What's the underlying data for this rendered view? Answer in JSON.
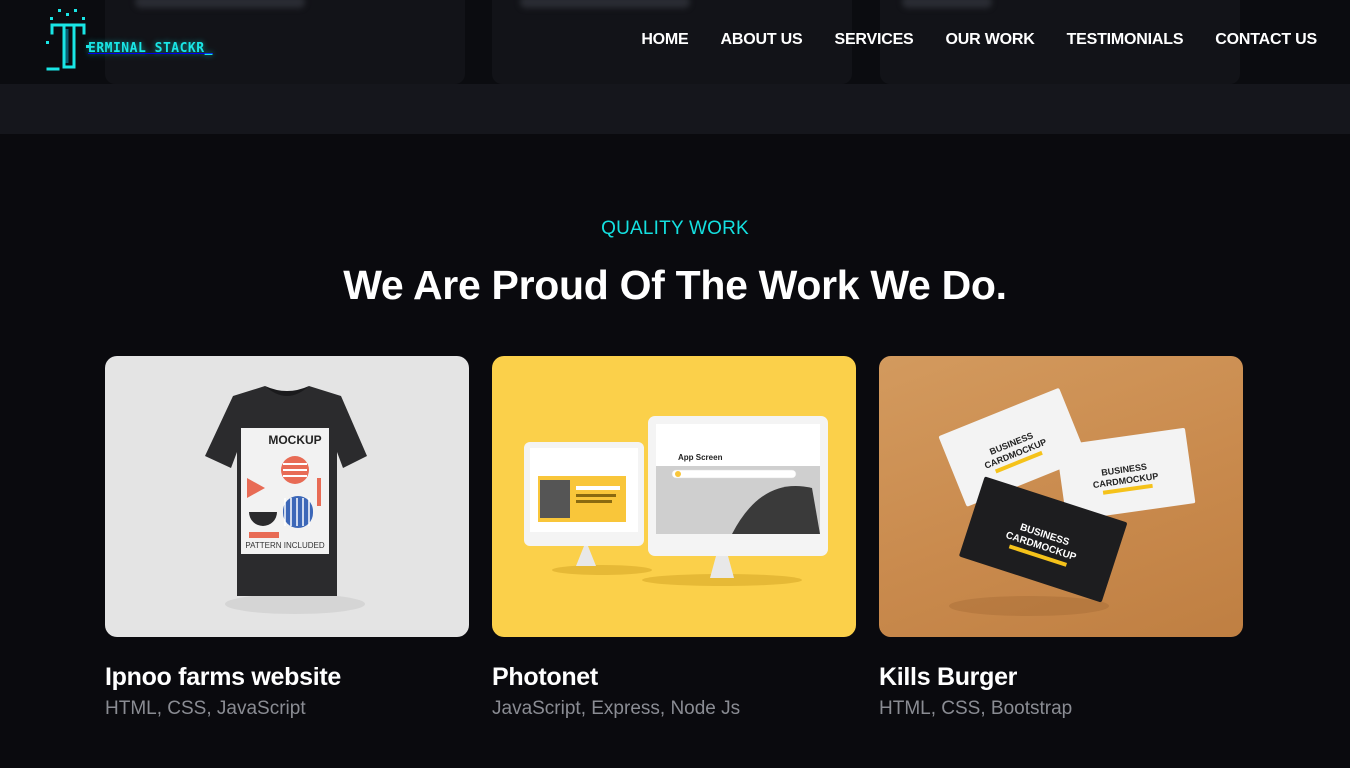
{
  "brand": {
    "logo_text": "ERMINAL STACKR_",
    "accent_color": "#19e6e6"
  },
  "nav": {
    "items": [
      "HOME",
      "ABOUT US",
      "SERVICES",
      "OUR WORK",
      "TESTIMONIALS",
      "CONTACT US"
    ]
  },
  "section": {
    "eyebrow": "QUALITY WORK",
    "heading": "We Are Proud Of The Work We Do."
  },
  "projects": [
    {
      "title": "Ipnoo farms website",
      "tags": "HTML, CSS, JavaScript",
      "image": {
        "icon": "tshirt-mockup-icon",
        "label_top": "MOCKUP",
        "label_bottom": "PATTERN INCLUDED"
      }
    },
    {
      "title": "Photonet",
      "tags": "JavaScript, Express, Node Js",
      "image": {
        "icon": "monitor-mockup-icon",
        "screen_title": "App Screen"
      }
    },
    {
      "title": "Kills Burger",
      "tags": "HTML, CSS, Bootstrap",
      "image": {
        "icon": "business-card-mockup-icon",
        "card_line1": "BUSINESS",
        "card_line2": "CARDMOCKUP"
      }
    }
  ]
}
